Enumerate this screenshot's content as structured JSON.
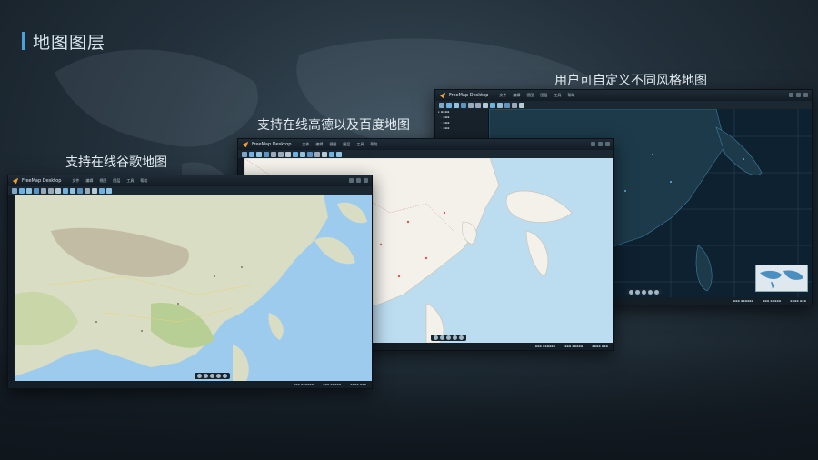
{
  "slide": {
    "title": "地图图层"
  },
  "captions": {
    "google": "支持在线谷歌地图",
    "gaode_baidu": "支持在线高德以及百度地图",
    "custom": "用户可自定义不同风格地图"
  },
  "app": {
    "name": "FreeMap Desktop",
    "menu": [
      "文件",
      "编辑",
      "视图",
      "图层",
      "工具",
      "帮助"
    ]
  },
  "colors": {
    "accent": "#4aa3d8",
    "google_land": "#d9ddc4",
    "google_sea": "#9ccbee",
    "gaode_land": "#f3f1ea",
    "gaode_sea": "#bcdcf0",
    "dark_land": "#1d3a4a",
    "dark_sea": "#0e2130"
  }
}
